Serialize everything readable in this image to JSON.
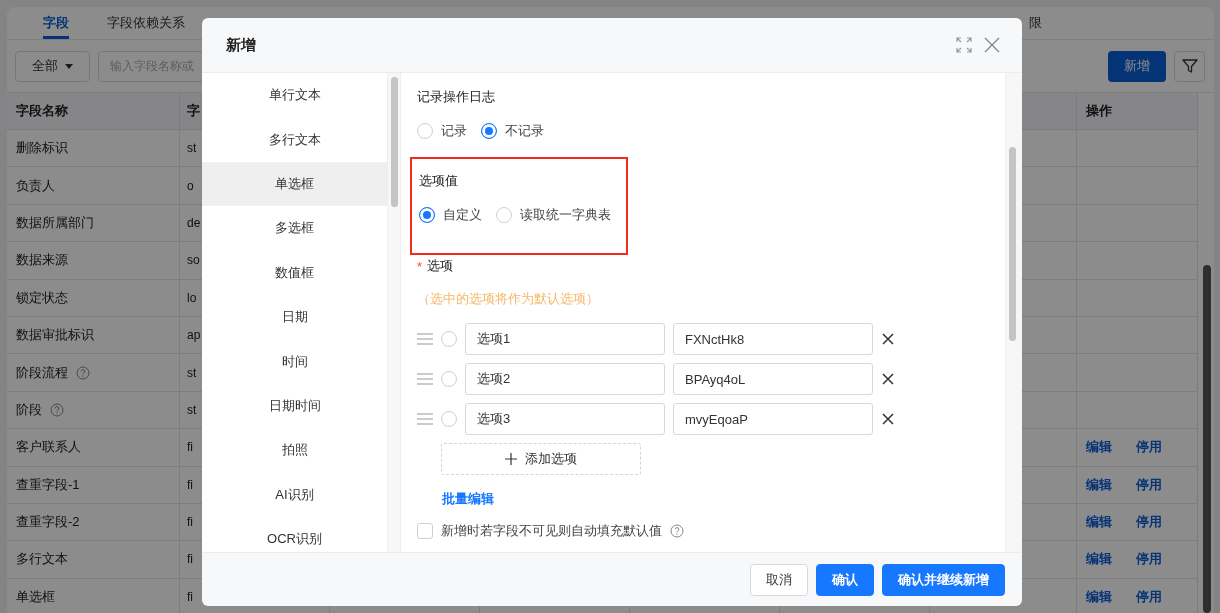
{
  "background": {
    "tabs": [
      {
        "label": "字段",
        "selected": true
      },
      {
        "label": "字段依赖关系",
        "selected": false
      },
      {
        "label": "限",
        "selected": false
      }
    ],
    "filter_dropdown": {
      "value": "全部"
    },
    "search": {
      "placeholder": "输入字段名称或"
    },
    "add_button": "新增",
    "table": {
      "columns": [
        {
          "label": "字段名称"
        },
        {
          "label": "字"
        },
        {
          "label": "操作"
        }
      ],
      "rows": [
        {
          "name": "删除标识",
          "column_2": "st",
          "help": false
        },
        {
          "name": "负责人",
          "column_2": "o",
          "help": false
        },
        {
          "name": "数据所属部门",
          "column_2": "de",
          "help": false
        },
        {
          "name": "数据来源",
          "column_2": "so",
          "help": false
        },
        {
          "name": "锁定状态",
          "column_2": "lo",
          "help": false
        },
        {
          "name": "数据审批标识",
          "column_2": "ap",
          "help": false
        },
        {
          "name": "阶段流程",
          "column_2": "st",
          "help": true
        },
        {
          "name": "阶段",
          "column_2": "st",
          "help": true
        },
        {
          "name": "客户联系人",
          "column_2": "fi",
          "help": false,
          "actions": [
            "编辑",
            "停用"
          ]
        },
        {
          "name": "查重字段-1",
          "column_2": "fi",
          "help": false,
          "actions": [
            "编辑",
            "停用"
          ]
        },
        {
          "name": "查重字段-2",
          "column_2": "fi",
          "help": false,
          "actions": [
            "编辑",
            "停用"
          ]
        },
        {
          "name": "多行文本",
          "column_2": "fi",
          "help": false,
          "actions": [
            "编辑",
            "停用"
          ]
        },
        {
          "name": "单选框",
          "column_2": "fi",
          "help": false,
          "actions": [
            "编辑",
            "停用"
          ]
        }
      ]
    }
  },
  "dialog": {
    "title": "新增",
    "field_types": [
      {
        "label": "单行文本",
        "selected": false
      },
      {
        "label": "多行文本",
        "selected": false
      },
      {
        "label": "单选框",
        "selected": true
      },
      {
        "label": "多选框",
        "selected": false
      },
      {
        "label": "数值框",
        "selected": false
      },
      {
        "label": "日期",
        "selected": false
      },
      {
        "label": "时间",
        "selected": false
      },
      {
        "label": "日期时间",
        "selected": false
      },
      {
        "label": "拍照",
        "selected": false
      },
      {
        "label": "AI识别",
        "selected": false
      },
      {
        "label": "OCR识别",
        "selected": false
      }
    ],
    "log_setting": {
      "label": "记录操作日志",
      "options": [
        {
          "label": "记录",
          "selected": false
        },
        {
          "label": "不记录",
          "selected": true
        }
      ]
    },
    "option_source": {
      "label": "选项值",
      "highlighted": true,
      "options": [
        {
          "label": "自定义",
          "selected": true
        },
        {
          "label": "读取统一字典表",
          "selected": false
        }
      ]
    },
    "options_field": {
      "required_mark": "*",
      "label": "选项",
      "hint": "（选中的选项将作为默认选项）",
      "items": [
        {
          "label": "选项1",
          "value": "FXNctHk8",
          "selected": false
        },
        {
          "label": "选项2",
          "value": "BPAyq4oL",
          "selected": false
        },
        {
          "label": "选项3",
          "value": "mvyEqoaP",
          "selected": false
        }
      ],
      "add_button": "添加选项",
      "batch_edit_link": "批量编辑"
    },
    "auto_fill": {
      "label": "新增时若字段不可见则自动填充默认值",
      "checked": false
    },
    "buttons": [
      {
        "label": "取消",
        "kind": "default"
      },
      {
        "label": "确认",
        "kind": "primary"
      },
      {
        "label": "确认并继续新增",
        "kind": "primary"
      }
    ]
  }
}
